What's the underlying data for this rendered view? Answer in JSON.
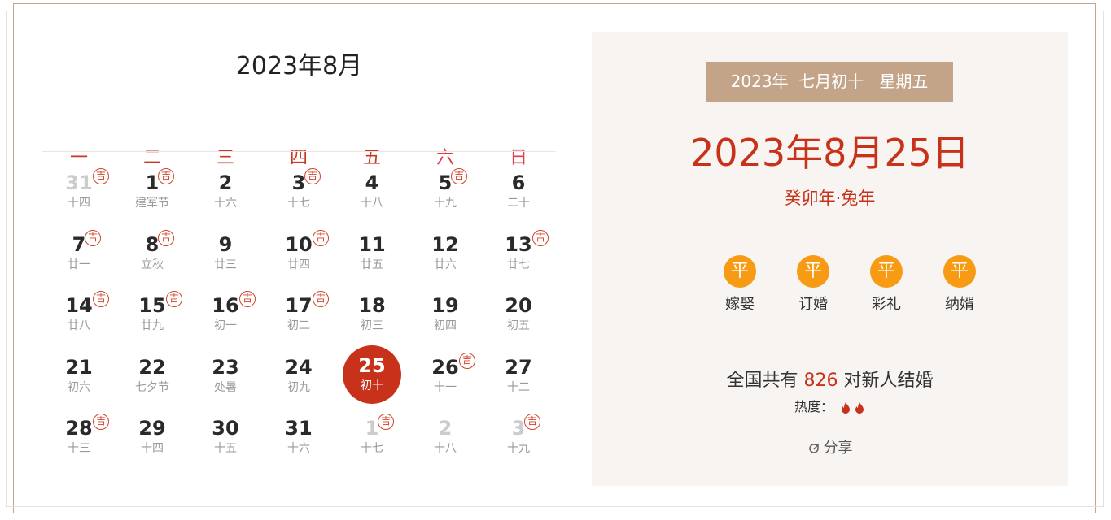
{
  "calendar": {
    "title": "2023年8月",
    "weekdays": [
      "一",
      "二",
      "三",
      "四",
      "五",
      "六",
      "日"
    ],
    "ji_label": "吉",
    "weeks": [
      [
        {
          "day": "31",
          "lunar": "十四",
          "ji": true,
          "other": true
        },
        {
          "day": "1",
          "lunar": "建军节",
          "ji": true
        },
        {
          "day": "2",
          "lunar": "十六",
          "ji": false
        },
        {
          "day": "3",
          "lunar": "十七",
          "ji": true
        },
        {
          "day": "4",
          "lunar": "十八",
          "ji": false
        },
        {
          "day": "5",
          "lunar": "十九",
          "ji": true
        },
        {
          "day": "6",
          "lunar": "二十",
          "ji": false
        }
      ],
      [
        {
          "day": "7",
          "lunar": "廿一",
          "ji": true
        },
        {
          "day": "8",
          "lunar": "立秋",
          "ji": true
        },
        {
          "day": "9",
          "lunar": "廿三",
          "ji": false
        },
        {
          "day": "10",
          "lunar": "廿四",
          "ji": true
        },
        {
          "day": "11",
          "lunar": "廿五",
          "ji": false
        },
        {
          "day": "12",
          "lunar": "廿六",
          "ji": false
        },
        {
          "day": "13",
          "lunar": "廿七",
          "ji": true
        }
      ],
      [
        {
          "day": "14",
          "lunar": "廿八",
          "ji": true
        },
        {
          "day": "15",
          "lunar": "廿九",
          "ji": true
        },
        {
          "day": "16",
          "lunar": "初一",
          "ji": true
        },
        {
          "day": "17",
          "lunar": "初二",
          "ji": true
        },
        {
          "day": "18",
          "lunar": "初三",
          "ji": false
        },
        {
          "day": "19",
          "lunar": "初四",
          "ji": false
        },
        {
          "day": "20",
          "lunar": "初五",
          "ji": false
        }
      ],
      [
        {
          "day": "21",
          "lunar": "初六",
          "ji": false
        },
        {
          "day": "22",
          "lunar": "七夕节",
          "ji": false
        },
        {
          "day": "23",
          "lunar": "处暑",
          "ji": false
        },
        {
          "day": "24",
          "lunar": "初九",
          "ji": false
        },
        {
          "day": "25",
          "lunar": "初十",
          "ji": false,
          "today": true
        },
        {
          "day": "26",
          "lunar": "十一",
          "ji": true
        },
        {
          "day": "27",
          "lunar": "十二",
          "ji": false
        }
      ],
      [
        {
          "day": "28",
          "lunar": "十三",
          "ji": true
        },
        {
          "day": "29",
          "lunar": "十四",
          "ji": false
        },
        {
          "day": "30",
          "lunar": "十五",
          "ji": false
        },
        {
          "day": "31",
          "lunar": "十六",
          "ji": false
        },
        {
          "day": "1",
          "lunar": "十七",
          "ji": true,
          "other": true
        },
        {
          "day": "2",
          "lunar": "十八",
          "ji": false,
          "other": true
        },
        {
          "day": "3",
          "lunar": "十九",
          "ji": true,
          "other": true
        }
      ]
    ]
  },
  "detail": {
    "lunar_line": "2023年  七月初十   星期五",
    "date": "2023年8月25日",
    "ganzhi": "癸卯年·兔年",
    "items": [
      {
        "badge": "平",
        "label": "嫁娶"
      },
      {
        "badge": "平",
        "label": "订婚"
      },
      {
        "badge": "平",
        "label": "彩礼"
      },
      {
        "badge": "平",
        "label": "纳婿"
      }
    ],
    "stat_prefix": "全国共有 ",
    "stat_count": "826",
    "stat_suffix": " 对新人结婚",
    "heat_label": "热度：",
    "heat_level": 2,
    "share_label": "分享"
  },
  "colors": {
    "accent_red": "#c8321a",
    "weekend_red": "#e63a4c",
    "badge_orange": "#f69b13",
    "lunar_bar": "#c3a488",
    "panel_bg": "#f8f4f1"
  }
}
